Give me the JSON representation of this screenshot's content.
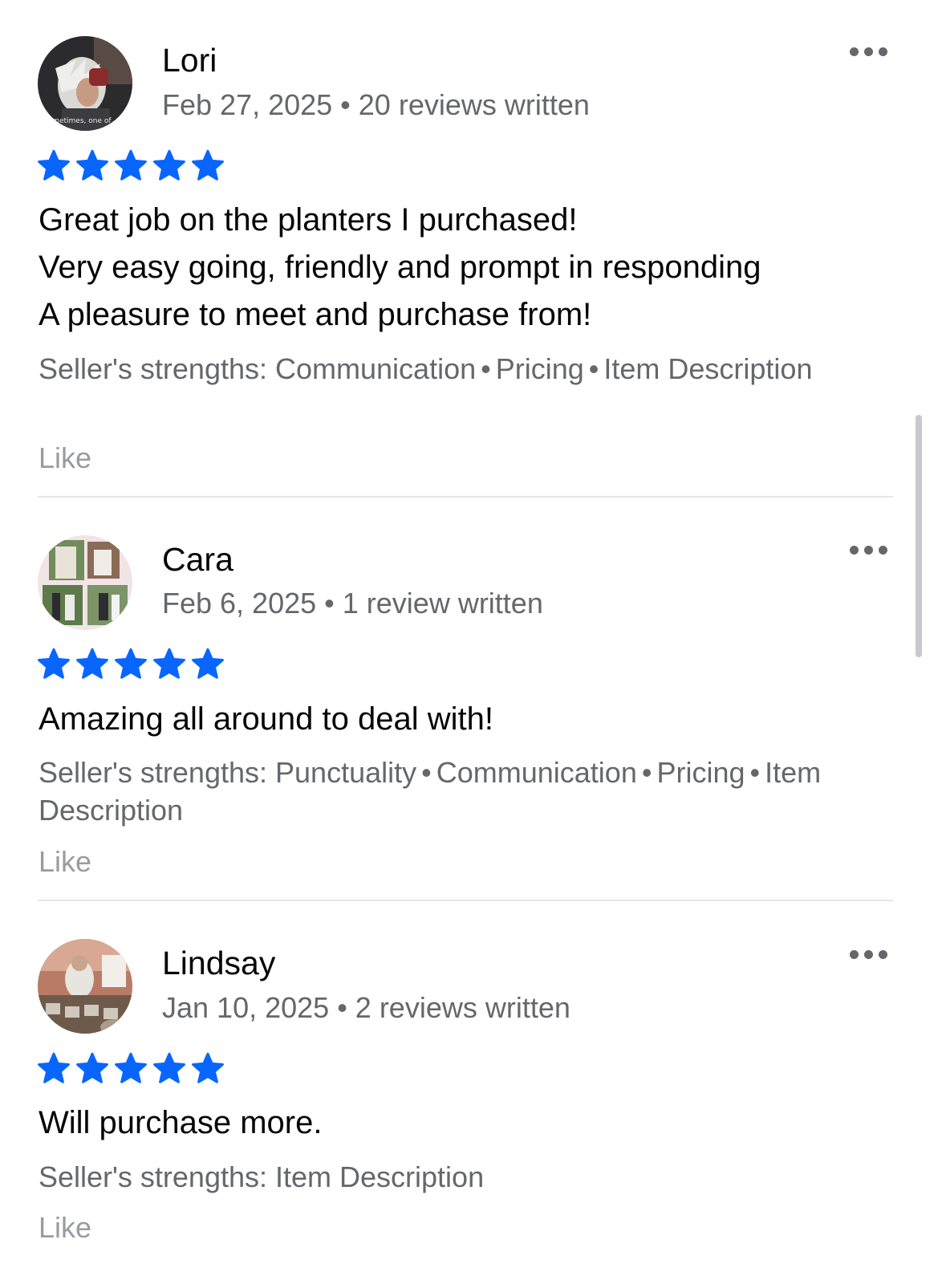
{
  "reviews": [
    {
      "name": "Lori",
      "date": "Feb 27, 2025",
      "separator": "•",
      "reviews_written": "20 reviews written",
      "rating": 5,
      "body_lines": [
        "Great job on the planters I purchased!",
        "Very easy going, friendly and prompt in responding",
        "A pleasure to meet and purchase from!"
      ],
      "strengths_label": "Seller's strengths:",
      "strengths": [
        "Communication",
        "Pricing",
        "Item Description"
      ],
      "like_label": "Like",
      "avatar_icon": "avatar-photo",
      "avatar_text": "sometimes, one of"
    },
    {
      "name": "Cara",
      "date": "Feb 6, 2025",
      "separator": "•",
      "reviews_written": "1 review written",
      "rating": 5,
      "body_lines": [
        "Amazing all around to deal with!"
      ],
      "strengths_label": "Seller's strengths:",
      "strengths": [
        "Punctuality",
        "Communication",
        "Pricing",
        "Item Description"
      ],
      "like_label": "Like",
      "avatar_icon": "avatar-photo-collage"
    },
    {
      "name": "Lindsay",
      "date": "Jan 10, 2025",
      "separator": "•",
      "reviews_written": "2 reviews written",
      "rating": 5,
      "body_lines": [
        "Will purchase more."
      ],
      "strengths_label": "Seller's strengths:",
      "strengths": [
        "Item Description"
      ],
      "like_label": "Like",
      "avatar_icon": "avatar-photo"
    }
  ],
  "colors": {
    "star": "#0866ff",
    "secondary_text": "#65676b",
    "like_text": "#9a9ca0",
    "divider": "#e4e6eb"
  },
  "icons": {
    "star": "star-icon",
    "more": "more-horizontal-icon"
  }
}
